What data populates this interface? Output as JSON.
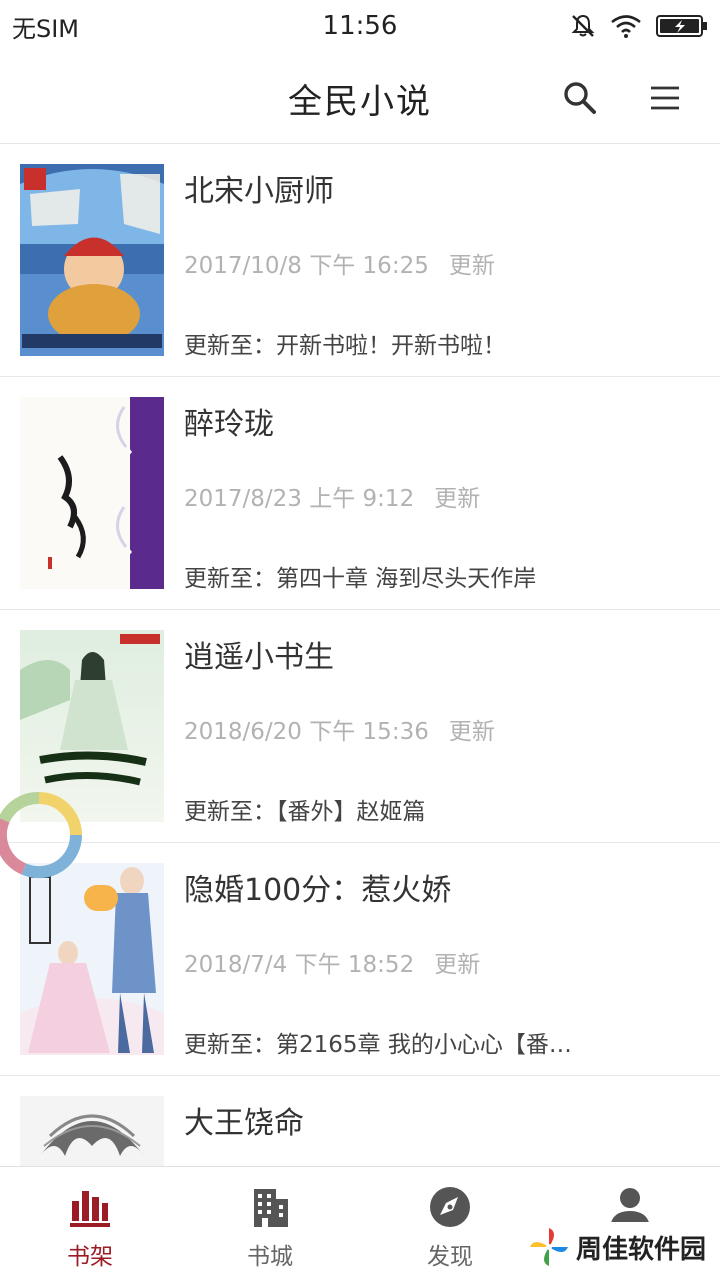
{
  "status_bar": {
    "carrier": "无SIM",
    "time": "11:56"
  },
  "header": {
    "title": "全民小说"
  },
  "books": [
    {
      "title": "北宋小厨师",
      "update_time": "2017/10/8 下午 16:25",
      "update_label": "更新",
      "latest": "更新至：开新书啦！开新书啦！"
    },
    {
      "title": "醉玲珑",
      "update_time": "2017/8/23 上午 9:12",
      "update_label": "更新",
      "latest": "更新至：第四十章 海到尽头天作岸"
    },
    {
      "title": "逍遥小书生",
      "update_time": "2018/6/20 下午 15:36",
      "update_label": "更新",
      "latest": "更新至：【番外】赵姬篇"
    },
    {
      "title": "隐婚100分：惹火娇",
      "update_time": "2018/7/4 下午 18:52",
      "update_label": "更新",
      "latest": "更新至：第2165章 我的小心心【番…"
    },
    {
      "title": "大王饶命",
      "update_time": "",
      "update_label": "",
      "latest": ""
    }
  ],
  "tabs": [
    {
      "label": "书架",
      "icon": "bookshelf-icon",
      "active": true
    },
    {
      "label": "书城",
      "icon": "building-icon",
      "active": false
    },
    {
      "label": "发现",
      "icon": "compass-icon",
      "active": false
    },
    {
      "label": "我的",
      "icon": "user-icon",
      "active": false
    }
  ],
  "watermark": {
    "text": "周佳软件园"
  },
  "colors": {
    "accent": "#9b1c24",
    "tab_inactive": "#666666",
    "secondary_text": "#b2b2b2"
  }
}
